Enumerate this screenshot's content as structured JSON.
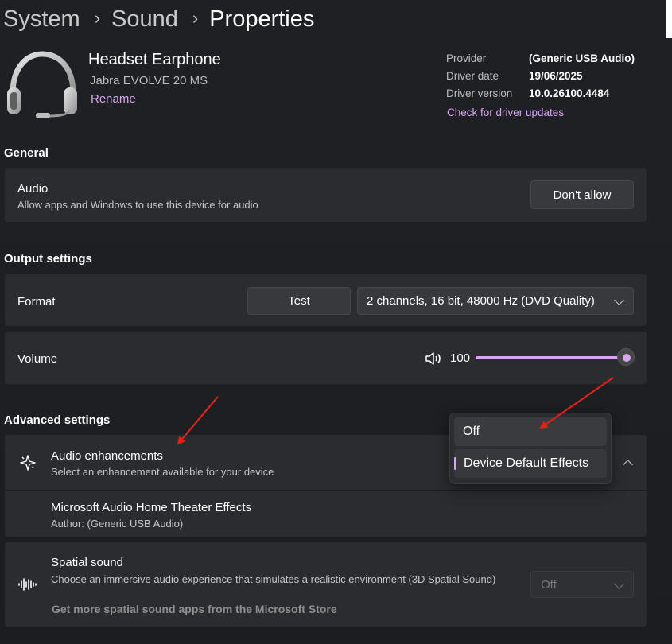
{
  "breadcrumb": {
    "items": [
      "System",
      "Sound"
    ],
    "current": "Properties"
  },
  "device": {
    "name": "Headset Earphone",
    "model": "Jabra EVOLVE 20 MS",
    "rename_label": "Rename",
    "icon": "headset-icon"
  },
  "driver": {
    "rows": [
      {
        "key": "Provider",
        "value": "(Generic USB Audio)"
      },
      {
        "key": "Driver date",
        "value": "19/06/2025"
      },
      {
        "key": "Driver version",
        "value": "10.0.26100.4484"
      }
    ],
    "update_link": "Check for driver updates"
  },
  "general": {
    "title": "General",
    "audio": {
      "title": "Audio",
      "subtitle": "Allow apps and Windows to use this device for audio",
      "button": "Don't allow"
    }
  },
  "output": {
    "title": "Output settings",
    "format": {
      "label": "Format",
      "test_button": "Test",
      "selected": "2 channels, 16 bit, 48000 Hz (DVD Quality)"
    },
    "volume": {
      "label": "Volume",
      "value": "100",
      "level": 1.0,
      "icon": "speaker-icon"
    }
  },
  "advanced": {
    "title": "Advanced settings",
    "enhancements": {
      "title": "Audio enhancements",
      "subtitle": "Select an enhancement available for your device",
      "icon": "sparkle-icon",
      "menu": {
        "options": [
          "Off",
          "Device Default Effects"
        ],
        "selected": "Device Default Effects",
        "hovered": "Off"
      }
    },
    "theater": {
      "title": "Microsoft Audio Home Theater Effects",
      "author": "Author: (Generic USB Audio)"
    },
    "spatial": {
      "title": "Spatial sound",
      "subtitle": "Choose an immersive audio experience that simulates a realistic environment (3D Spatial Sound)",
      "store_link": "Get more spatial sound apps from the Microsoft Store",
      "dropdown_value": "Off",
      "icon": "waveform-icon"
    }
  },
  "colors": {
    "accent": "#d7a6f0",
    "annotation_arrow": "#e0201b",
    "background": "#202124",
    "card": "#2b2c2f"
  }
}
